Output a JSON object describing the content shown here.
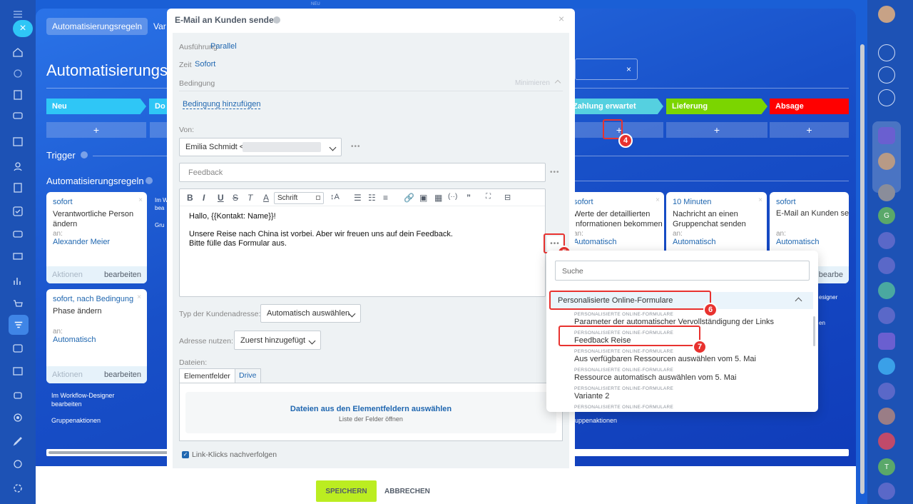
{
  "background": {
    "tabs": [
      "Automatisierungsregeln",
      "Var"
    ],
    "page_title": "Automatisierungsreg",
    "stages": [
      {
        "label": "Neu",
        "color": "#2fc6f6"
      },
      {
        "label": "Do",
        "color": "#2fc6f6"
      },
      {
        "label": "Zahlung erwartet",
        "color": "#55d0e0"
      },
      {
        "label": "Lieferung",
        "color": "#7bd500"
      },
      {
        "label": "Absage",
        "color": "#ff0000"
      }
    ],
    "trigger_label": "Trigger",
    "rules_label": "Automatisierungsregeln",
    "plus": "+",
    "cards": [
      {
        "time": "sofort",
        "title": "Verantwortliche Person ändern",
        "an": "an:",
        "target": "Alexander Meier",
        "actions": "Aktionen",
        "edit": "bearbeiten"
      },
      {
        "time": "sofort, nach Bedingung",
        "title": "Phase ändern",
        "an": "an:",
        "target": "Automatisch",
        "actions": "Aktionen",
        "edit": "bearbeiten"
      },
      {
        "time": "sofort",
        "title": "Werte der detaillierten Informationen bekommen",
        "an": "an:",
        "target": "Automatisch"
      },
      {
        "time": "10 Minuten",
        "title": "Nachricht an einen Gruppenchat senden",
        "an": "an:",
        "target": "Automatisch"
      },
      {
        "time": "sofort",
        "title": "E-Mail an Kunden se",
        "an": "an:",
        "target": "Automatisch",
        "edit": "bearbe"
      }
    ],
    "workflow_link": "Im Workflow-Designer bearbeiten",
    "group_actions": "Gruppenaktionen",
    "group_actions_right": "uppenaktionen",
    "partial_left": [
      "Im W",
      "bea",
      "Gru"
    ],
    "partial_right": [
      "esigner",
      "en"
    ]
  },
  "modal": {
    "title": "E-Mail an Kunden senden",
    "execution_label": "Ausführung",
    "execution_value": "Parallel",
    "time_label": "Zeit",
    "time_value": "Sofort",
    "condition_label": "Bedingung",
    "minimize": "Minimieren",
    "add_condition": "Bedingung hinzufügen",
    "from_label": "Von:",
    "from_value": "Emilia Schmidt <",
    "subject_placeholder": "Feedback",
    "font_select": "Schrift",
    "body_line1": "Hallo, {{Kontakt: Name}}!",
    "body_line2": "Unsere Reise nach China ist vorbei. Aber wir freuen uns auf dein Feedback.",
    "body_line3": "Bitte fülle das Formular aus.",
    "address_type_label": "Typ der Kundenadresse:",
    "address_type_value": "Automatisch auswählen",
    "use_address_label": "Adresse nutzen:",
    "use_address_value": "Zuerst hinzugefügt",
    "files_label": "Dateien:",
    "tab_fields": "Elementfelder",
    "tab_drive": "Drive",
    "files_link": "Dateien aus den Elementfeldern auswählen",
    "files_sub": "Liste der Felder öffnen",
    "track_clicks": "Link-Klicks nachverfolgen",
    "save": "SPEICHERN",
    "cancel": "ABBRECHEN"
  },
  "popup": {
    "search_placeholder": "Suche",
    "section": "Personalisierte Online-Formulare",
    "items": [
      {
        "category": "PERSONALISIERTE ONLINE-FORMULARE",
        "name": "Parameter der automatischer Vervollständigung der Links"
      },
      {
        "category": "PERSONALISIERTE ONLINE-FORMULARE",
        "name": "Feedback Reise"
      },
      {
        "category": "PERSONALISIERTE ONLINE-FORMULARE",
        "name": "Aus verfügbaren Ressourcen auswählen vom 5. Mai"
      },
      {
        "category": "PERSONALISIERTE ONLINE-FORMULARE",
        "name": "Ressource automatisch auswählen vom 5. Mai"
      },
      {
        "category": "PERSONALISIERTE ONLINE-FORMULARE",
        "name": "Variante 2"
      },
      {
        "category": "PERSONALISIERTE ONLINE-FORMULARE",
        "name": ""
      }
    ]
  },
  "steps": [
    "4",
    "5",
    "6",
    "7"
  ],
  "right_sidebar": [
    "G",
    "T"
  ],
  "top_label": "NEU"
}
